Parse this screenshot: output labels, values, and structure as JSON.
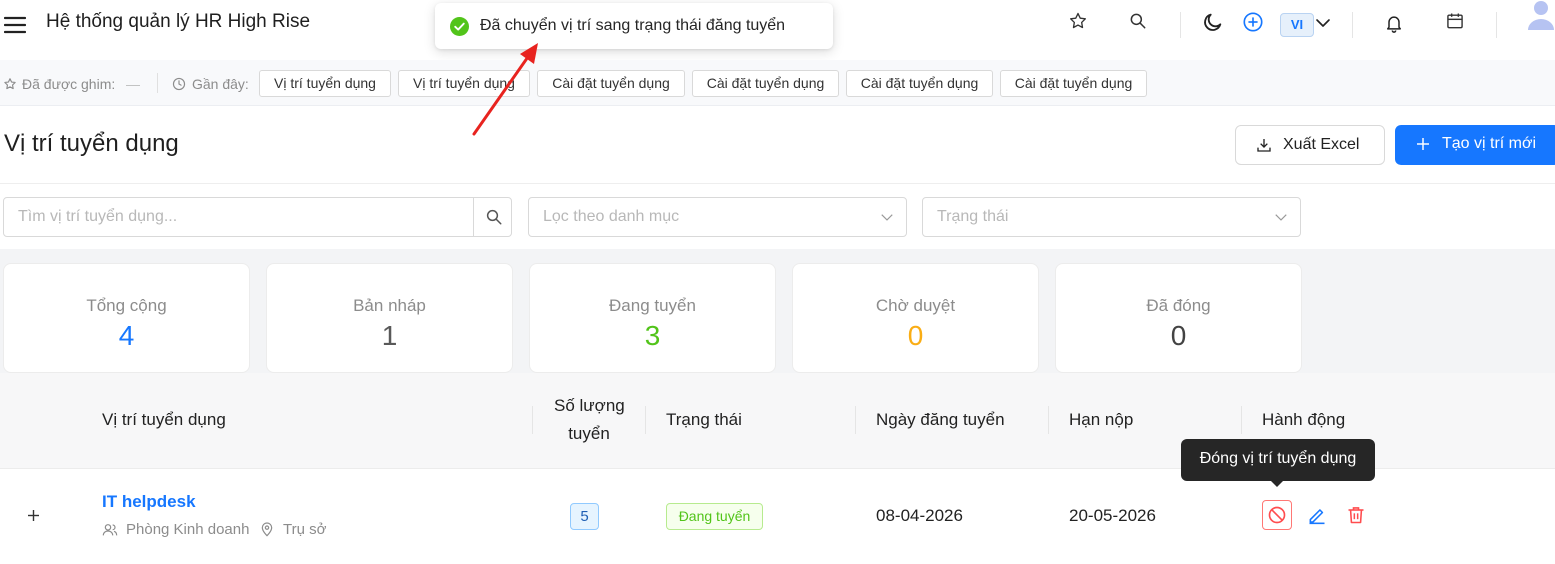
{
  "header": {
    "app_title": "Hệ thống quản lý HR High Rise",
    "language": "VI"
  },
  "toast": {
    "message": "Đã chuyển vị trí sang trạng thái đăng tuyển"
  },
  "pinbar": {
    "pinned_label": "Đã được ghim:",
    "pinned_value": "—",
    "recent_label": "Gần đây:",
    "recent_chips": [
      "Vị trí tuyển dụng",
      "Vị trí tuyển dụng",
      "Cài đặt tuyển dụng",
      "Cài đặt tuyển dụng",
      "Cài đặt tuyển dụng",
      "Cài đặt tuyển dụng"
    ]
  },
  "page": {
    "title": "Vị trí tuyển dụng",
    "export_label": "Xuất Excel",
    "create_label": "Tạo vị trí mới"
  },
  "filters": {
    "search_placeholder": "Tìm vị trí tuyển dụng...",
    "category_placeholder": "Lọc theo danh mục",
    "status_placeholder": "Trạng thái"
  },
  "stats": [
    {
      "label": "Tổng cộng",
      "value": "4",
      "color": "#1677ff"
    },
    {
      "label": "Bản nháp",
      "value": "1",
      "color": "#595959"
    },
    {
      "label": "Đang tuyển",
      "value": "3",
      "color": "#52c41a"
    },
    {
      "label": "Chờ duyệt",
      "value": "0",
      "color": "#faad14"
    },
    {
      "label": "Đã đóng",
      "value": "0",
      "color": "#434343"
    }
  ],
  "table": {
    "headers": {
      "position": "Vị trí tuyển dụng",
      "quantity_line1": "Số lượng",
      "quantity_line2": "tuyển",
      "status": "Trạng thái",
      "posted_date": "Ngày đăng tuyển",
      "deadline": "Hạn nộp",
      "actions": "Hành động"
    },
    "rows": [
      {
        "name": "IT helpdesk",
        "department": "Phòng Kinh doanh",
        "location": "Trụ sở",
        "quantity": "5",
        "status": "Đang tuyển",
        "posted_date": "08-04-2026",
        "deadline": "20-05-2026"
      }
    ]
  },
  "tooltip": {
    "text": "Đóng vị trí tuyển dụng"
  },
  "colors": {
    "primary": "#1677ff",
    "success": "#52c41a",
    "danger": "#ff4d4f",
    "annotation": "#e8231f"
  }
}
